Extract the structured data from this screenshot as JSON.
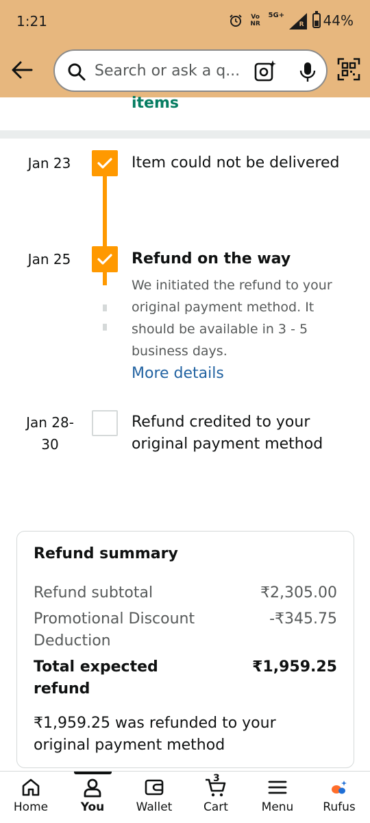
{
  "status_bar": {
    "time": "1:21",
    "volte": "Vo NR",
    "network": "5G+",
    "roaming": "R",
    "battery": "44%",
    "battery_level": 0.44
  },
  "search": {
    "placeholder": "Search or ask a q..."
  },
  "previous_section_text": "items",
  "timeline": [
    {
      "date": "Jan 23",
      "title": "Item could not be delivered",
      "done": true
    },
    {
      "date": "Jan 25",
      "title": "Refund on the way",
      "description": "We initiated the refund to your original payment method. It should be available in 3 - 5 business days.",
      "link": "More details",
      "done": true
    },
    {
      "date": "Jan 28-30",
      "title": "Refund credited to your original payment method",
      "done": false
    }
  ],
  "refund_summary": {
    "title": "Refund summary",
    "subtotal_label": "Refund subtotal",
    "subtotal_value": "₹2,305.00",
    "discount_label": "Promotional Discount Deduction",
    "discount_value": "-₹345.75",
    "total_label": "Total expected refund",
    "total_value": "₹1,959.25",
    "note": "₹1,959.25 was refunded to your original payment method"
  },
  "bottom_nav": [
    {
      "label": "Home",
      "icon": "home-icon"
    },
    {
      "label": "You",
      "icon": "person-icon",
      "active": true
    },
    {
      "label": "Wallet",
      "icon": "wallet-icon"
    },
    {
      "label": "Cart",
      "icon": "cart-icon",
      "badge": "3"
    },
    {
      "label": "Menu",
      "icon": "menu-icon"
    },
    {
      "label": "Rufus",
      "icon": "rufus-icon"
    }
  ],
  "colors": {
    "header": "#e7b77e",
    "accent": "#ff9900",
    "link": "#2162a1",
    "green": "#067d62"
  }
}
